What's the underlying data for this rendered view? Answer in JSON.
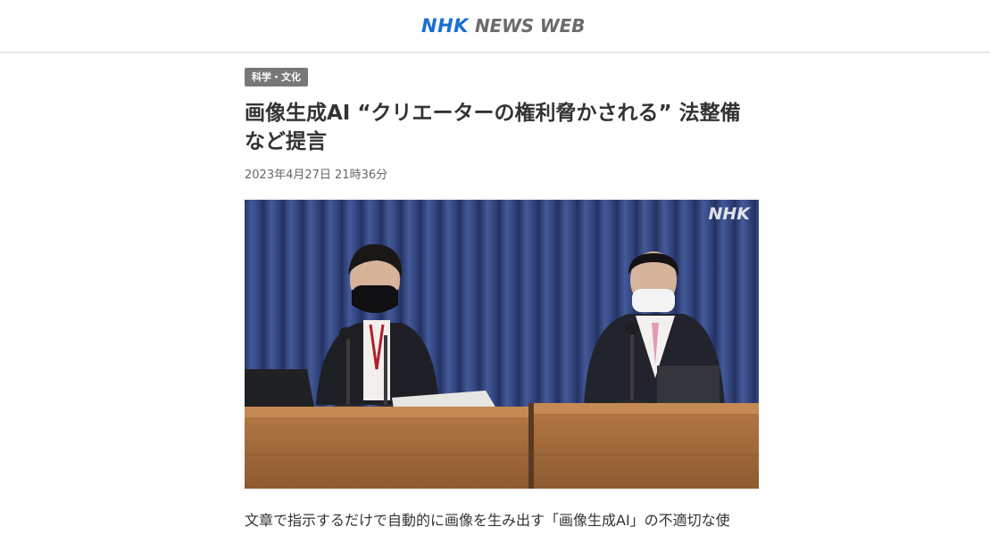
{
  "header": {
    "logo_nhk": "NHK",
    "logo_newsweb": "NEWS WEB"
  },
  "article": {
    "category": "科学・文化",
    "title": "画像生成AI “クリエーターの権利脅かされる” 法整備など提言",
    "date": "2023年4月27日 21時36分",
    "photo_watermark": "NHK",
    "body_first_line": "文章で指示するだけで自動的に画像を生み出す「画像生成AI」の不適切な使"
  },
  "colors": {
    "brand_blue": "#1a6fd1",
    "logo_gray": "#6b6b6b",
    "category_bg": "#777777",
    "curtain_blue": "#3b4f8c",
    "desk_wood": "#a06a3c"
  },
  "icons": {
    "logo": "nhk-news-web-logo",
    "photo": "press-conference-photo"
  }
}
